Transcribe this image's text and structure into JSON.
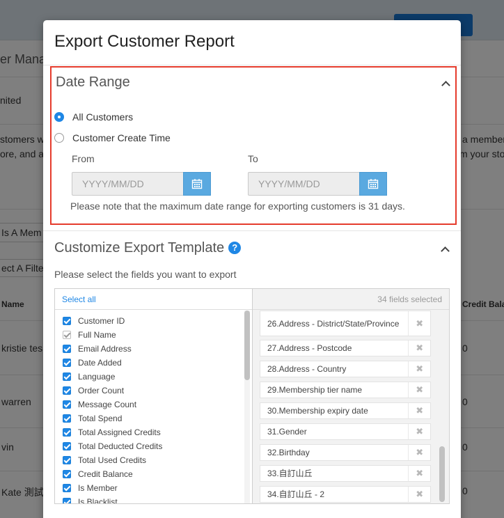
{
  "background": {
    "title_fragment": "er Mana",
    "row1_text": "nited",
    "desc_line1_left": "stomers wh",
    "desc_line2_left": "ore, and a",
    "desc_line1_right": "a member",
    "desc_line2_right": "m your sto",
    "input_fragment": "Is A Mem",
    "filter_fragment": "ect A Filter",
    "col_name": "Name",
    "col_credit": "Credit Bala",
    "rows": [
      {
        "name": "kristie tes",
        "credit": "0"
      },
      {
        "name": "warren",
        "credit": "0"
      },
      {
        "name": "vin",
        "credit": "0"
      },
      {
        "name": "Kate 測試",
        "credit": "0"
      }
    ]
  },
  "modal": {
    "title": "Export Customer Report",
    "date_range": {
      "title": "Date Range",
      "options": [
        "All Customers",
        "Customer Create Time"
      ],
      "selected_option": "All Customers",
      "from_label": "From",
      "to_label": "To",
      "from_placeholder": "YYYY/MM/DD",
      "to_placeholder": "YYYY/MM/DD",
      "note": "Please note that the maximum date range for exporting customers is 31 days."
    },
    "template": {
      "title": "Customize Export Template",
      "help_icon": "?",
      "instruction": "Please select the fields you want to export",
      "select_all": "Select all",
      "selected_count": "34 fields selected",
      "available_fields": [
        {
          "label": "Customer ID",
          "checked": true,
          "disabled": false
        },
        {
          "label": "Full Name",
          "checked": true,
          "disabled": true
        },
        {
          "label": "Email Address",
          "checked": true,
          "disabled": false
        },
        {
          "label": "Date Added",
          "checked": true,
          "disabled": false
        },
        {
          "label": "Language",
          "checked": true,
          "disabled": false
        },
        {
          "label": "Order Count",
          "checked": true,
          "disabled": false
        },
        {
          "label": "Message Count",
          "checked": true,
          "disabled": false
        },
        {
          "label": "Total Spend",
          "checked": true,
          "disabled": false
        },
        {
          "label": "Total Assigned Credits",
          "checked": true,
          "disabled": false
        },
        {
          "label": "Total Deducted Credits",
          "checked": true,
          "disabled": false
        },
        {
          "label": "Total Used Credits",
          "checked": true,
          "disabled": false
        },
        {
          "label": "Credit Balance",
          "checked": true,
          "disabled": false
        },
        {
          "label": "Is Member",
          "checked": true,
          "disabled": false
        },
        {
          "label": "Is Blacklist",
          "checked": true,
          "disabled": false
        }
      ],
      "selected_fields": [
        "26.Address - District/State/Province",
        "27.Address - Postcode",
        "28.Address - Country",
        "29.Membership tier name",
        "30.Membership expiry date",
        "31.Gender",
        "32.Birthday",
        "33.自訂山丘",
        "34.自訂山丘 - 2"
      ],
      "remove_icon": "✖"
    }
  },
  "colors": {
    "accent": "#1f87e5",
    "highlight_border": "#e53b2c",
    "calendar_button": "#5aa9e0"
  }
}
